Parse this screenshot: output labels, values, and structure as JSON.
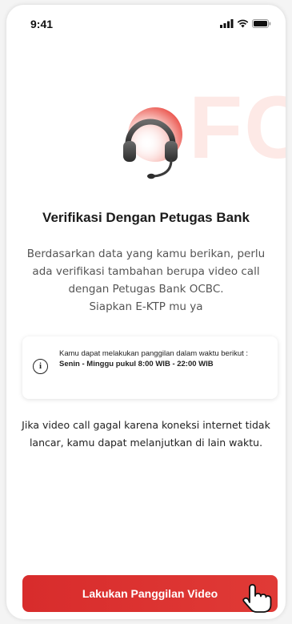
{
  "status_bar": {
    "time": "9:41",
    "icons": [
      "signal-icon",
      "wifi-icon",
      "battery-icon"
    ]
  },
  "watermark": "FC",
  "title": "Verifikasi Dengan Petugas Bank",
  "description": {
    "line1": "Berdasarkan data yang kamu berikan, perlu",
    "line2": "ada verifikasi tambahan berupa video call",
    "line3": "dengan Petugas Bank OCBC.",
    "line4": "Siapkan E-KTP mu ya"
  },
  "info_card": {
    "icon": "info-icon",
    "text_prefix": "Kamu dapat melakukan panggilan dalam waktu berikut : ",
    "text_bold": "Senin - Minggu pukul 8:00 WIB - 22:00 WIB"
  },
  "note": {
    "line1": "Jika video call gagal karena koneksi internet tidak",
    "line2": "lancar, kamu dapat melanjutkan di lain waktu."
  },
  "cta": {
    "label": "Lakukan Panggilan Video"
  },
  "colors": {
    "accent": "#d82c2c",
    "watermark": "#fde9e6"
  }
}
